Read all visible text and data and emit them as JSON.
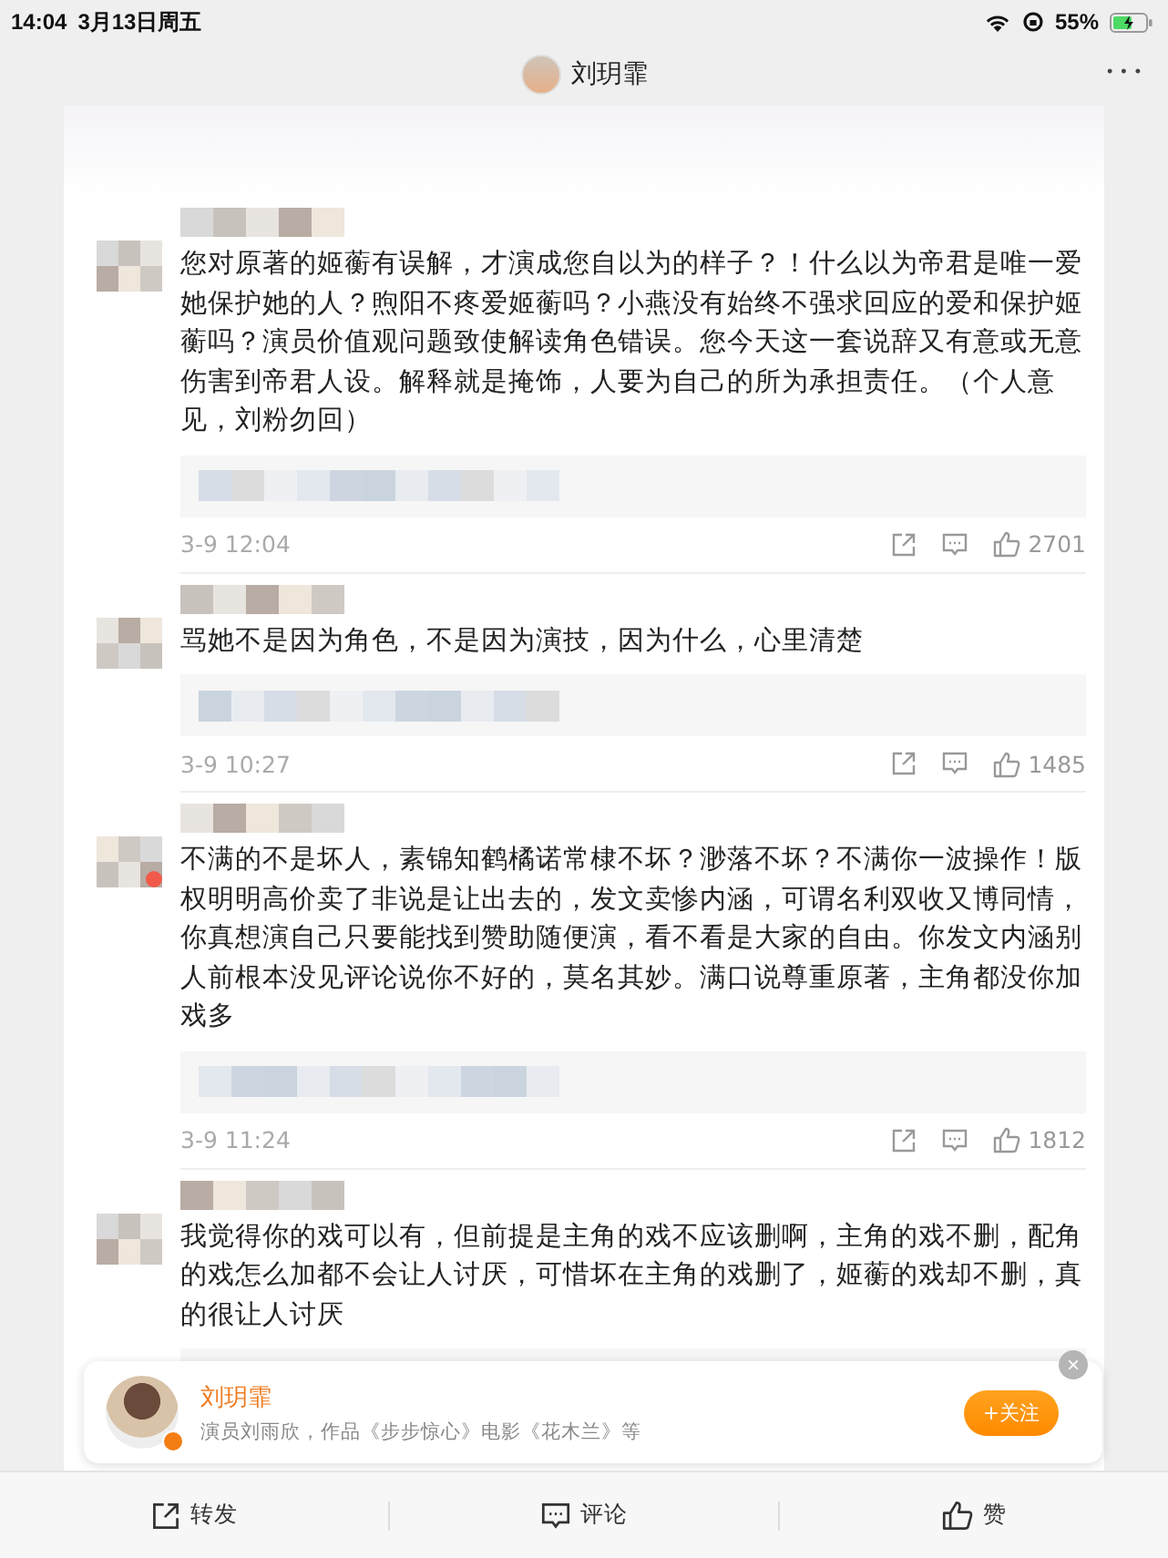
{
  "status_bar": {
    "time": "14:04",
    "date": "3月13日周五",
    "battery": "55%"
  },
  "header": {
    "title": "刘玥霏",
    "more": "• • •"
  },
  "comments": [
    {
      "text": "您对原著的姬蘅有误解，才演成您自以为的样子？！什么以为帝君是唯一爱她保护她的人？煦阳不疼爱姬蘅吗？小燕没有始终不强求回应的爱和保护姬蘅吗？演员价值观问题致使解读角色错误。您今天这一套说辞又有意或无意伤害到帝君人设。解释就是掩饰，人要为自己的所为承担责任。（个人意见，刘粉勿回）",
      "time": "3-9 12:04",
      "likes": "2701",
      "verified": false
    },
    {
      "text": "骂她不是因为角色，不是因为演技，因为什么，心里清楚",
      "time": "3-9 10:27",
      "likes": "1485",
      "verified": false
    },
    {
      "text": "不满的不是坏人，素锦知鹤橘诺常棣不坏？渺落不坏？不满你一波操作！版权明明高价卖了非说是让出去的，发文卖惨内涵，可谓名利双收又博同情，你真想演自己只要能找到赞助随便演，看不看是大家的自由。你发文内涵别人前根本没见评论说你不好的，莫名其妙。满口说尊重原著，主角都没你加戏多",
      "time": "3-9 11:24",
      "likes": "1812",
      "verified": true
    },
    {
      "text": "我觉得你的戏可以有，但前提是主角的戏不应该删啊，主角的戏不删，配角的戏怎么加都不会让人讨厌，可惜坏在主角的戏删了，姬蘅的戏却不删，真的很让人讨厌",
      "verified": false
    }
  ],
  "popup": {
    "name": "刘玥霏",
    "description": "演员刘雨欣，作品《步步惊心》电影《花木兰》等",
    "follow": "+关注",
    "close": "×"
  },
  "bottom_bar": [
    {
      "kind": "share",
      "label": "转发"
    },
    {
      "kind": "comment",
      "label": "评论"
    },
    {
      "kind": "like",
      "label": "赞"
    }
  ]
}
